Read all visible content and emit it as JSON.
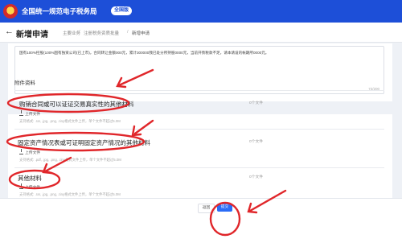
{
  "app": {
    "title": "全国统一规范电子税务局",
    "badge": "全国版"
  },
  "header": {
    "page_title": "新增申请",
    "breadcrumbs": [
      "主要业务",
      "注册税务资质批量",
      "新增申请"
    ]
  },
  "form": {
    "description_text": "国有100%控股(100%国有独资公司(已上市)，合同转让金额000元，累计300000我已处分所持股0000元，当前开债税款不足，请本请设的帐期所0000元。",
    "char_count": "72/200"
  },
  "attachments": {
    "section_title": "附件资料",
    "items": [
      {
        "label": "购销合同或可以证证交易真实性的其他材料",
        "count": "0个文件",
        "upload_label": "上传文件",
        "hint": "支持格式: .rar, .jpg, .png, .tiny格式文件上传，单个文件不超过5.0M"
      },
      {
        "label": "固定资产情况表或可证明固定资产情况的其他材料",
        "count": "0个文件",
        "upload_label": "上传文件",
        "hint": "支持格式: .pdf, .jpg, .png, .tiny格式文件上传，单个文件不超过5.0M"
      },
      {
        "label": "其他材料",
        "count": "0个文件",
        "upload_label": "上传文件",
        "hint": "支持格式: .rar, .jpg, .png, .tiny格式文件上传，单个文件不超过5.0M"
      }
    ]
  },
  "footer": {
    "back_label": "返回",
    "submit_label": "提交"
  },
  "colors": {
    "topbar": "#1d4fd8",
    "primary_button": "#2b6cf6",
    "annotation": "#e0262a"
  },
  "icons": [
    "emblem-icon",
    "back-arrow-icon",
    "upload-icon",
    "annotation-arrow"
  ]
}
